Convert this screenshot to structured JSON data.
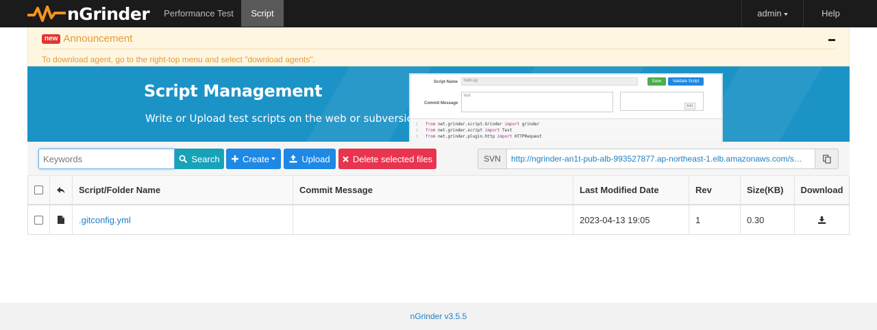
{
  "nav": {
    "brand": "nGrinder",
    "items": [
      {
        "label": "Performance Test"
      },
      {
        "label": "Script"
      }
    ],
    "user": "admin",
    "help": "Help"
  },
  "announcement": {
    "badge": "new",
    "title": "Announcement",
    "body": "To download agent, go to the right-top menu and select \"download agents\"."
  },
  "banner": {
    "title": "Script Management",
    "subtitle": "Write or Upload test scripts on the web or subversion",
    "mock": {
      "script_name_label": "Script Name",
      "script_name_value": "hello.py",
      "save": "Save",
      "validate": "Validate Script",
      "commit_label": "Commit Message",
      "commit_value": "test",
      "add": "Add",
      "code": [
        {
          "num": "1",
          "a": "from ",
          "b": "net.grinder.script.Grinder ",
          "c": "import ",
          "d": "grinder"
        },
        {
          "num": "2",
          "a": "from ",
          "b": "net.grinder.script ",
          "c": "import ",
          "d": "Test"
        },
        {
          "num": "3",
          "a": "from ",
          "b": "net.grinder.plugin.http ",
          "c": "import ",
          "d": "HTTPRequest"
        }
      ]
    }
  },
  "toolbar": {
    "search_placeholder": "Keywords",
    "search": "Search",
    "create": "Create",
    "upload": "Upload",
    "delete": "Delete selected files",
    "svn_label": "SVN",
    "svn_url": "http://ngrinder-an1t-pub-alb-993527877.ap-northeast-1.elb.amazonaws.com/s…"
  },
  "table": {
    "headers": {
      "name": "Script/Folder Name",
      "commit": "Commit Message",
      "date": "Last Modified Date",
      "rev": "Rev",
      "size": "Size(KB)",
      "download": "Download"
    },
    "rows": [
      {
        "name": ".gitconfig.yml",
        "commit": "",
        "date": "2023-04-13 19:05",
        "rev": "1",
        "size": "0.30"
      }
    ]
  },
  "footer": {
    "version": "nGrinder v3.5.5"
  },
  "colors": {
    "nav_bg": "#1b1b1b",
    "brand_orange": "#f7931e",
    "banner_bg": "#1c93c6",
    "search_btn": "#17a2b8",
    "primary_btn": "#1e88e5",
    "danger_btn": "#e8344e",
    "link": "#1e7fc0"
  }
}
